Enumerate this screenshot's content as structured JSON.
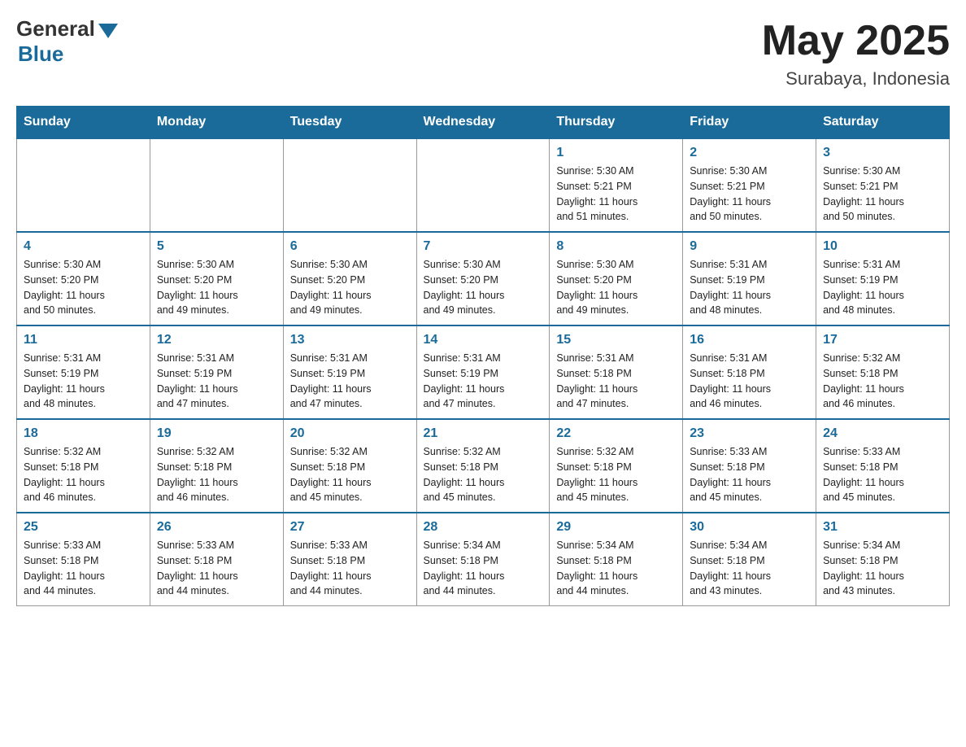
{
  "header": {
    "logo_general": "General",
    "logo_blue": "Blue",
    "month_title": "May 2025",
    "location": "Surabaya, Indonesia"
  },
  "weekdays": [
    "Sunday",
    "Monday",
    "Tuesday",
    "Wednesday",
    "Thursday",
    "Friday",
    "Saturday"
  ],
  "weeks": [
    [
      {
        "day": "",
        "info": ""
      },
      {
        "day": "",
        "info": ""
      },
      {
        "day": "",
        "info": ""
      },
      {
        "day": "",
        "info": ""
      },
      {
        "day": "1",
        "info": "Sunrise: 5:30 AM\nSunset: 5:21 PM\nDaylight: 11 hours\nand 51 minutes."
      },
      {
        "day": "2",
        "info": "Sunrise: 5:30 AM\nSunset: 5:21 PM\nDaylight: 11 hours\nand 50 minutes."
      },
      {
        "day": "3",
        "info": "Sunrise: 5:30 AM\nSunset: 5:21 PM\nDaylight: 11 hours\nand 50 minutes."
      }
    ],
    [
      {
        "day": "4",
        "info": "Sunrise: 5:30 AM\nSunset: 5:20 PM\nDaylight: 11 hours\nand 50 minutes."
      },
      {
        "day": "5",
        "info": "Sunrise: 5:30 AM\nSunset: 5:20 PM\nDaylight: 11 hours\nand 49 minutes."
      },
      {
        "day": "6",
        "info": "Sunrise: 5:30 AM\nSunset: 5:20 PM\nDaylight: 11 hours\nand 49 minutes."
      },
      {
        "day": "7",
        "info": "Sunrise: 5:30 AM\nSunset: 5:20 PM\nDaylight: 11 hours\nand 49 minutes."
      },
      {
        "day": "8",
        "info": "Sunrise: 5:30 AM\nSunset: 5:20 PM\nDaylight: 11 hours\nand 49 minutes."
      },
      {
        "day": "9",
        "info": "Sunrise: 5:31 AM\nSunset: 5:19 PM\nDaylight: 11 hours\nand 48 minutes."
      },
      {
        "day": "10",
        "info": "Sunrise: 5:31 AM\nSunset: 5:19 PM\nDaylight: 11 hours\nand 48 minutes."
      }
    ],
    [
      {
        "day": "11",
        "info": "Sunrise: 5:31 AM\nSunset: 5:19 PM\nDaylight: 11 hours\nand 48 minutes."
      },
      {
        "day": "12",
        "info": "Sunrise: 5:31 AM\nSunset: 5:19 PM\nDaylight: 11 hours\nand 47 minutes."
      },
      {
        "day": "13",
        "info": "Sunrise: 5:31 AM\nSunset: 5:19 PM\nDaylight: 11 hours\nand 47 minutes."
      },
      {
        "day": "14",
        "info": "Sunrise: 5:31 AM\nSunset: 5:19 PM\nDaylight: 11 hours\nand 47 minutes."
      },
      {
        "day": "15",
        "info": "Sunrise: 5:31 AM\nSunset: 5:18 PM\nDaylight: 11 hours\nand 47 minutes."
      },
      {
        "day": "16",
        "info": "Sunrise: 5:31 AM\nSunset: 5:18 PM\nDaylight: 11 hours\nand 46 minutes."
      },
      {
        "day": "17",
        "info": "Sunrise: 5:32 AM\nSunset: 5:18 PM\nDaylight: 11 hours\nand 46 minutes."
      }
    ],
    [
      {
        "day": "18",
        "info": "Sunrise: 5:32 AM\nSunset: 5:18 PM\nDaylight: 11 hours\nand 46 minutes."
      },
      {
        "day": "19",
        "info": "Sunrise: 5:32 AM\nSunset: 5:18 PM\nDaylight: 11 hours\nand 46 minutes."
      },
      {
        "day": "20",
        "info": "Sunrise: 5:32 AM\nSunset: 5:18 PM\nDaylight: 11 hours\nand 45 minutes."
      },
      {
        "day": "21",
        "info": "Sunrise: 5:32 AM\nSunset: 5:18 PM\nDaylight: 11 hours\nand 45 minutes."
      },
      {
        "day": "22",
        "info": "Sunrise: 5:32 AM\nSunset: 5:18 PM\nDaylight: 11 hours\nand 45 minutes."
      },
      {
        "day": "23",
        "info": "Sunrise: 5:33 AM\nSunset: 5:18 PM\nDaylight: 11 hours\nand 45 minutes."
      },
      {
        "day": "24",
        "info": "Sunrise: 5:33 AM\nSunset: 5:18 PM\nDaylight: 11 hours\nand 45 minutes."
      }
    ],
    [
      {
        "day": "25",
        "info": "Sunrise: 5:33 AM\nSunset: 5:18 PM\nDaylight: 11 hours\nand 44 minutes."
      },
      {
        "day": "26",
        "info": "Sunrise: 5:33 AM\nSunset: 5:18 PM\nDaylight: 11 hours\nand 44 minutes."
      },
      {
        "day": "27",
        "info": "Sunrise: 5:33 AM\nSunset: 5:18 PM\nDaylight: 11 hours\nand 44 minutes."
      },
      {
        "day": "28",
        "info": "Sunrise: 5:34 AM\nSunset: 5:18 PM\nDaylight: 11 hours\nand 44 minutes."
      },
      {
        "day": "29",
        "info": "Sunrise: 5:34 AM\nSunset: 5:18 PM\nDaylight: 11 hours\nand 44 minutes."
      },
      {
        "day": "30",
        "info": "Sunrise: 5:34 AM\nSunset: 5:18 PM\nDaylight: 11 hours\nand 43 minutes."
      },
      {
        "day": "31",
        "info": "Sunrise: 5:34 AM\nSunset: 5:18 PM\nDaylight: 11 hours\nand 43 minutes."
      }
    ]
  ]
}
